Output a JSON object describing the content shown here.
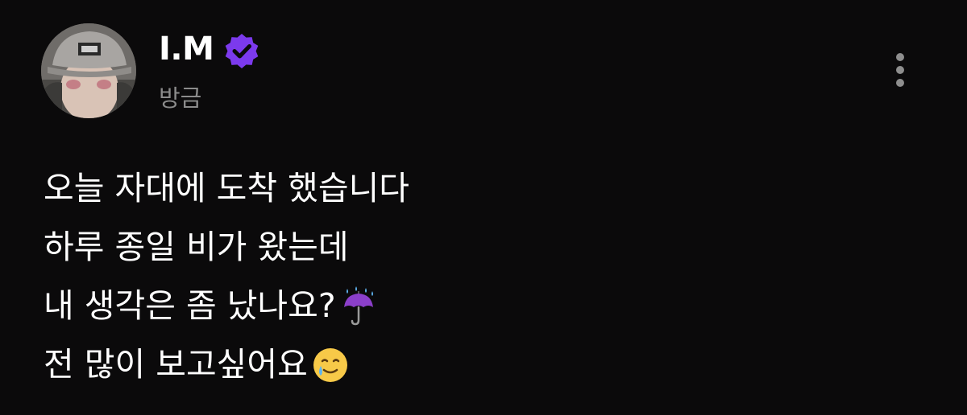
{
  "author": {
    "name": "I.M",
    "verified": true,
    "badge_color": "#7c3aed",
    "avatar_icon": "profile-photo"
  },
  "post": {
    "timestamp": "방금",
    "lines": [
      {
        "text": "오늘 자대에 도착 했습니다",
        "emoji": null
      },
      {
        "text": "하루 종일 비가 왔는데",
        "emoji": null
      },
      {
        "text": "내 생각은 좀 났나요?",
        "emoji": "umbrella-with-rain-icon"
      },
      {
        "text": "전 많이 보고싶어요",
        "emoji": "smiling-face-with-tear-icon"
      }
    ]
  },
  "menu": {
    "icon": "more-vertical-icon"
  },
  "colors": {
    "background": "#0b0a0b",
    "text": "#ffffff",
    "muted": "#8b8b8b"
  }
}
